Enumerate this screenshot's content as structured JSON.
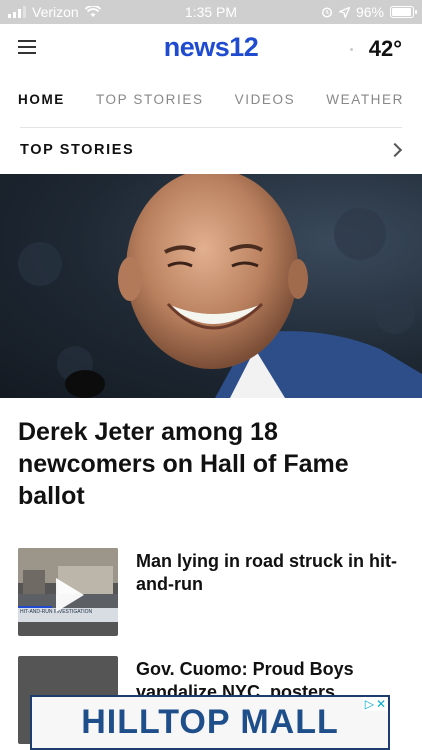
{
  "status_bar": {
    "carrier": "Verizon",
    "time": "1:35 PM",
    "battery": "96%",
    "battery_level": 0.96
  },
  "header": {
    "logo": "news12",
    "temperature": "42°"
  },
  "nav": {
    "tabs": [
      {
        "label": "HOME",
        "active": true
      },
      {
        "label": "TOP STORIES",
        "active": false
      },
      {
        "label": "VIDEOS",
        "active": false
      },
      {
        "label": "WEATHER",
        "active": false
      }
    ]
  },
  "section": {
    "title": "TOP STORIES"
  },
  "hero": {
    "headline": "Derek Jeter among 18 newcomers on Hall of Fame ballot"
  },
  "stories": [
    {
      "title": "Man lying in road struck in hit-and-run",
      "thumb_caption": "HIT-AND-RUN INVESTIGATION"
    },
    {
      "title": "Gov. Cuomo: Proud Boys vandalize NYC, posters"
    }
  ],
  "ad": {
    "text": "HILLTOP MALL"
  },
  "colors": {
    "brand": "#1f4bd1",
    "ad_accent": "#00aecd"
  },
  "icons": [
    "wifi-icon",
    "alarm-icon",
    "location-icon",
    "battery-icon",
    "menu-icon",
    "chevron-right-icon",
    "play-icon",
    "adchoices-icon",
    "ad-close-icon"
  ]
}
